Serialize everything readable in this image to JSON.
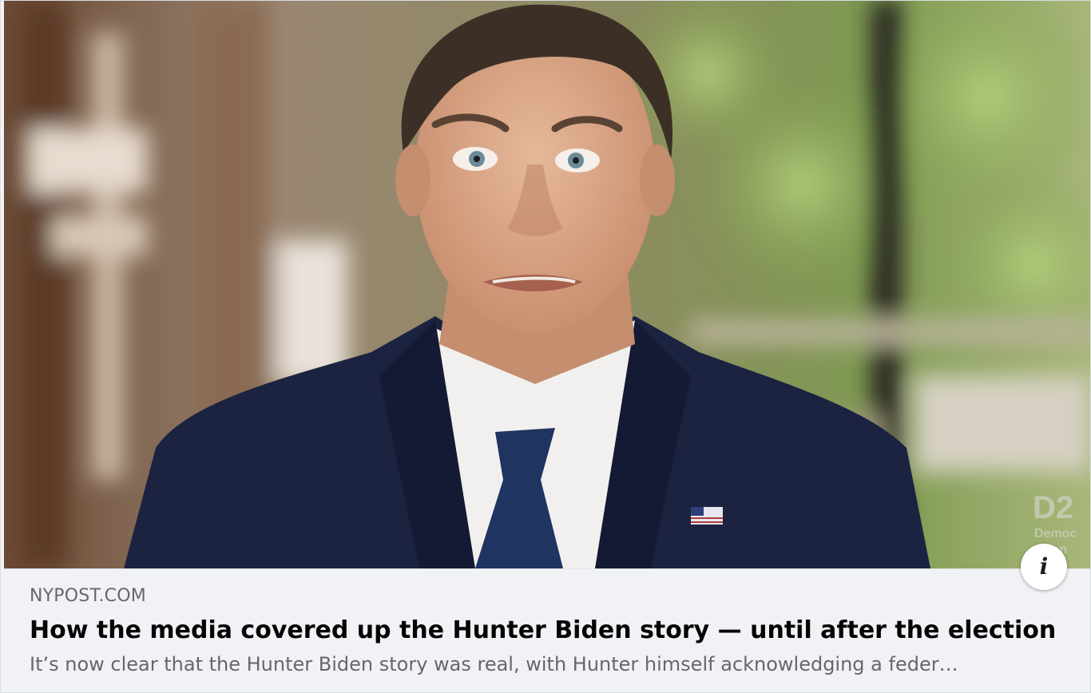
{
  "link_preview": {
    "image": {
      "description_icon": "photo",
      "watermark_text": [
        "D2",
        "Democ",
        "ntion"
      ]
    },
    "info_icon": "info-icon",
    "info_glyph": "i",
    "domain": "NYPOST.COM",
    "headline": "How the media covered up the Hunter Biden story — until after the election",
    "description": "It’s now clear that the Hunter Biden story was real, with Hunter himself acknowledging a feder…"
  },
  "colors": {
    "meta_background": "#f0f2f5",
    "headline": "#050505",
    "secondary_text": "#65676b",
    "suit": "#1b2340",
    "tie": "#1f3461",
    "shirt": "#f2f0ee",
    "skin": "#d9a585"
  }
}
